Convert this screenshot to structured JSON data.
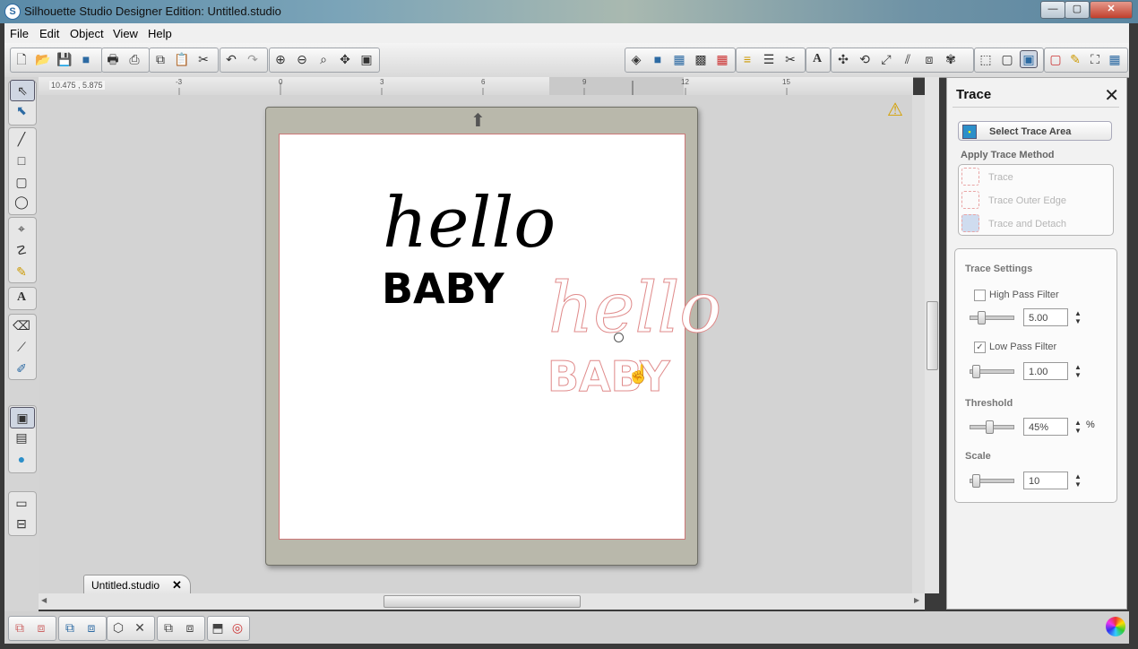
{
  "window": {
    "title": "Silhouette Studio Designer Edition: Untitled.studio",
    "logo": "S",
    "minimize": "—",
    "maximize": "▢",
    "close": "✕"
  },
  "menu": [
    "File",
    "Edit",
    "Object",
    "View",
    "Help"
  ],
  "ruler": {
    "coords": "10.475 , 5.875",
    "ticks": [
      "-3",
      "0",
      "3",
      "6",
      "9",
      "12",
      "15"
    ]
  },
  "canvas": {
    "design1": {
      "line1": "hello",
      "line2": "BABY"
    },
    "design2": {
      "line1": "hello",
      "line2": "BABY"
    },
    "warning_icon": "⚠",
    "mat_arrow": "⬆"
  },
  "doc_tab": {
    "label": "Untitled.studio",
    "close": "✕"
  },
  "trace_panel": {
    "title": "Trace",
    "close": "✕",
    "select_trace_area": "Select Trace Area",
    "apply_method_heading": "Apply Trace Method",
    "methods": [
      "Trace",
      "Trace Outer Edge",
      "Trace and Detach"
    ],
    "settings_heading": "Trace Settings",
    "high_pass": {
      "label": "High Pass Filter",
      "checked": false,
      "value": "5.00"
    },
    "low_pass": {
      "label": "Low Pass Filter",
      "checked": true,
      "value": "1.00"
    },
    "threshold": {
      "label": "Threshold",
      "value": "45%",
      "unit": "%"
    },
    "scale": {
      "label": "Scale",
      "value": "10"
    }
  },
  "colors": {
    "accent": "#2c6aa3",
    "trace_red": "#e08b8b",
    "mat": "#b9b8ab"
  }
}
